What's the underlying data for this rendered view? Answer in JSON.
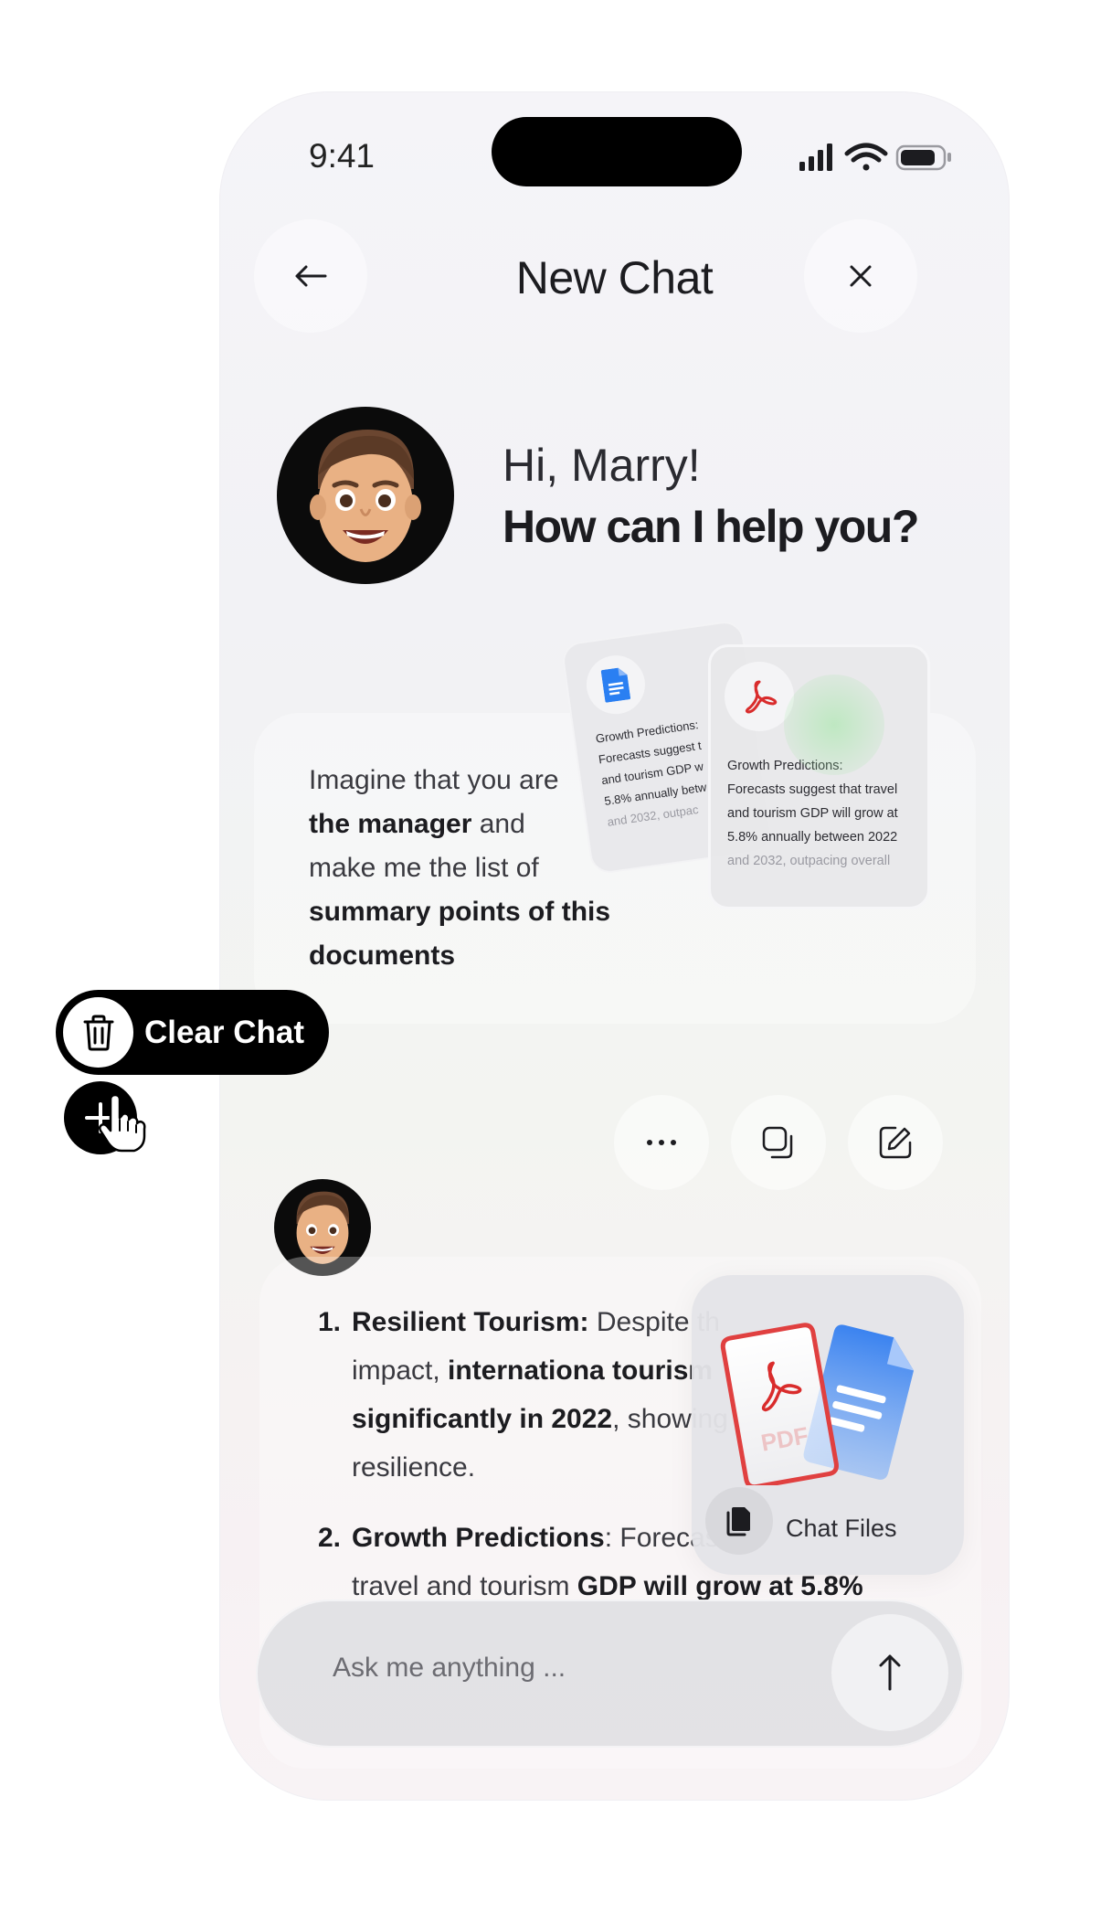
{
  "status": {
    "time": "9:41"
  },
  "header": {
    "title": "New Chat",
    "back_icon": "arrow-left-icon",
    "close_icon": "close-icon"
  },
  "greeting": {
    "line1": "Hi, Marry!",
    "line2": "How can I help you?"
  },
  "prompt": {
    "p1": "Imagine that you are",
    "p2_bold": "the manager",
    "p2_rest": " and",
    "p3": "make me the list of",
    "p4_bold": "summary points of this",
    "p5_bold": "documents"
  },
  "doc_back": {
    "l1": "Growth Predictions:",
    "l2": "Forecasts suggest t",
    "l3": "and tourism GDP w",
    "l4": "5.8% annually betw",
    "l5": "and 2032, outpac"
  },
  "doc_front": {
    "l1": "Growth Predictions:",
    "l2": "Forecasts suggest that travel",
    "l3": "and tourism GDP will grow at",
    "l4": "5.8% annually between 2022",
    "l5": "and 2032, outpacing overall"
  },
  "actions": {
    "more": "more-icon",
    "copy": "copy-icon",
    "edit": "edit-icon"
  },
  "answer": {
    "item1": {
      "num": "1.",
      "title": "Resilient Tourism:",
      "t1": " Despite th",
      "t2": "impact, ",
      "b2": "internationa tourism",
      "b3": "significantly in 2022",
      "t3": ", showing",
      "t4": "resilience."
    },
    "item2": {
      "num": "2.",
      "title": "Growth Predictions",
      "t1": ": Forecasts",
      "t2": "travel and tourism ",
      "b2": "GDP will grow at 5.8%"
    }
  },
  "files": {
    "label": "Chat Files",
    "pdf_text": "PDF"
  },
  "composer": {
    "placeholder": "Ask me anything ..."
  },
  "clear_chat": {
    "label": "Clear Chat"
  }
}
